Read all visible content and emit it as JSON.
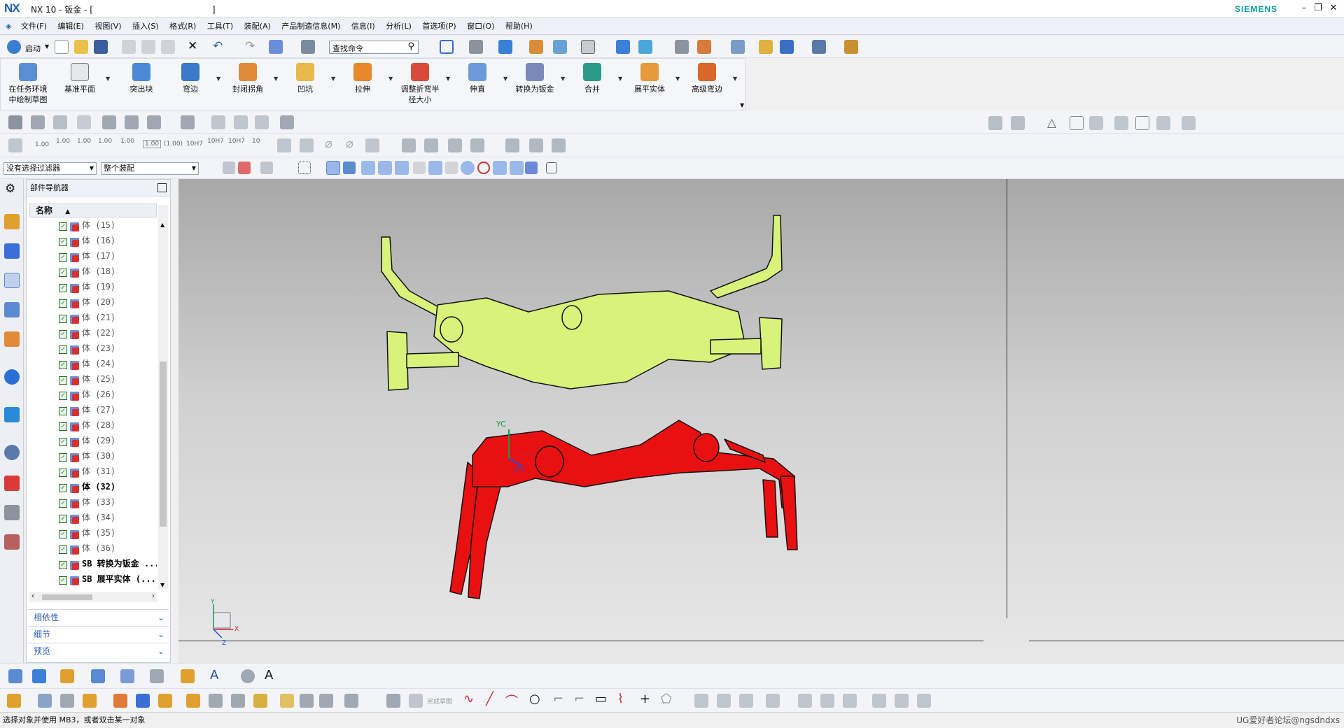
{
  "title": {
    "logo": "NX",
    "text": "NX 10 - 钣金 - [",
    "bracket": "]",
    "brand": "SIEMENS"
  },
  "menu": [
    "文件(F)",
    "编辑(E)",
    "视图(V)",
    "插入(S)",
    "格式(R)",
    "工具(T)",
    "装配(A)",
    "产品制造信息(M)",
    "信息(I)",
    "分析(L)",
    "首选项(P)",
    "窗口(O)",
    "帮助(H)"
  ],
  "toolbar": {
    "start_label": "启动",
    "search_placeholder": "查找命令"
  },
  "ribbon": [
    "在任务环境\n中绘制草图",
    "基准平面",
    "突出块",
    "弯边",
    "封闭拐角",
    "凹坑",
    "拉伸",
    "调整折弯半\n径大小",
    "伸直",
    "转换为钣金",
    "合并",
    "展平实体",
    "高级弯边"
  ],
  "dim_labels": [
    "1.00",
    "1.00",
    "1.00",
    "1.00",
    "1.00",
    "1.00",
    "(1.00)",
    "10H7",
    "10H7",
    "10H7",
    "10"
  ],
  "filters": {
    "select_filter": "没有选择过滤器",
    "assembly_scope": "整个装配"
  },
  "navigator": {
    "title": "部件导航器",
    "column": "名称",
    "rows": [
      "体 (15)",
      "体 (16)",
      "体 (17)",
      "体 (18)",
      "体 (19)",
      "体 (20)",
      "体 (21)",
      "体 (22)",
      "体 (23)",
      "体 (24)",
      "体 (25)",
      "体 (26)",
      "体 (27)",
      "体 (28)",
      "体 (29)",
      "体 (30)",
      "体 (31)",
      "体 (32)",
      "体 (33)",
      "体 (34)",
      "体 (35)",
      "体 (36)",
      "SB 转换为钣金 ...",
      "SB 展平实体 (..."
    ],
    "sections": [
      "相依性",
      "细节",
      "预览"
    ]
  },
  "viewport": {
    "yc": "YC",
    "xc": "XC",
    "zc": "ZC",
    "y": "Y",
    "x": "X",
    "z": "Z"
  },
  "bottom": {
    "sketch_finish": "完成草图"
  },
  "status": {
    "text": "选择对象并使用 MB3，或者双击某一对象",
    "watermark": "UG爱好者论坛@ngsdndxs"
  },
  "colors": {
    "accent": "#1f5da8",
    "part_red": "#e81010",
    "part_green": "#d8f27a"
  }
}
